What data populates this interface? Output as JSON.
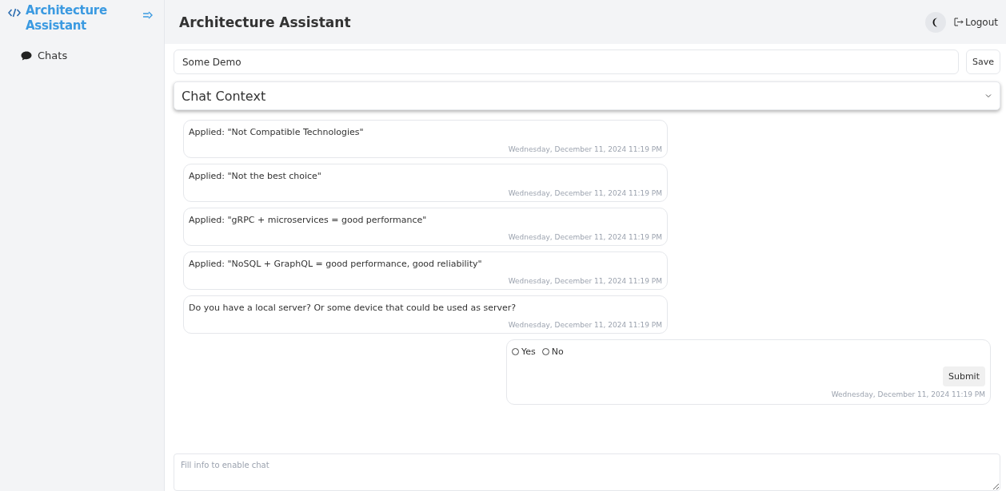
{
  "sidebar": {
    "brand": "Architecture Assistant",
    "items": [
      {
        "label": "Chats",
        "selected": false
      }
    ]
  },
  "header": {
    "title": "Architecture Assistant",
    "logout": "Logout"
  },
  "chat_name": {
    "value": "Some Demo",
    "save": "Save"
  },
  "context": {
    "title": "Chat Context",
    "expanded": false
  },
  "messages": [
    {
      "kind": "text",
      "text": "Applied: \"Not Compatible Technologies\"",
      "time": "Wednesday, December 11, 2024 11:19 PM"
    },
    {
      "kind": "text",
      "text": "Applied: \"Not the best choice\"",
      "time": "Wednesday, December 11, 2024 11:19 PM"
    },
    {
      "kind": "text",
      "text": "Applied: \"gRPC + microservices = good performance\"",
      "time": "Wednesday, December 11, 2024 11:19 PM"
    },
    {
      "kind": "text",
      "text": "Applied: \"NoSQL + GraphQL = good performance, good reliability\"",
      "time": "Wednesday, December 11, 2024 11:19 PM"
    },
    {
      "kind": "text",
      "text": "Do you have a local server? Or some device that could be used as server?",
      "time": "Wednesday, December 11, 2024 11:19 PM"
    },
    {
      "kind": "choice",
      "options": [
        {
          "label": "Yes",
          "selected": false
        },
        {
          "label": "No",
          "selected": false
        }
      ],
      "submit": "Submit",
      "time": "Wednesday, December 11, 2024 11:19 PM"
    }
  ],
  "composer": {
    "placeholder": "Fill info to enable chat"
  }
}
